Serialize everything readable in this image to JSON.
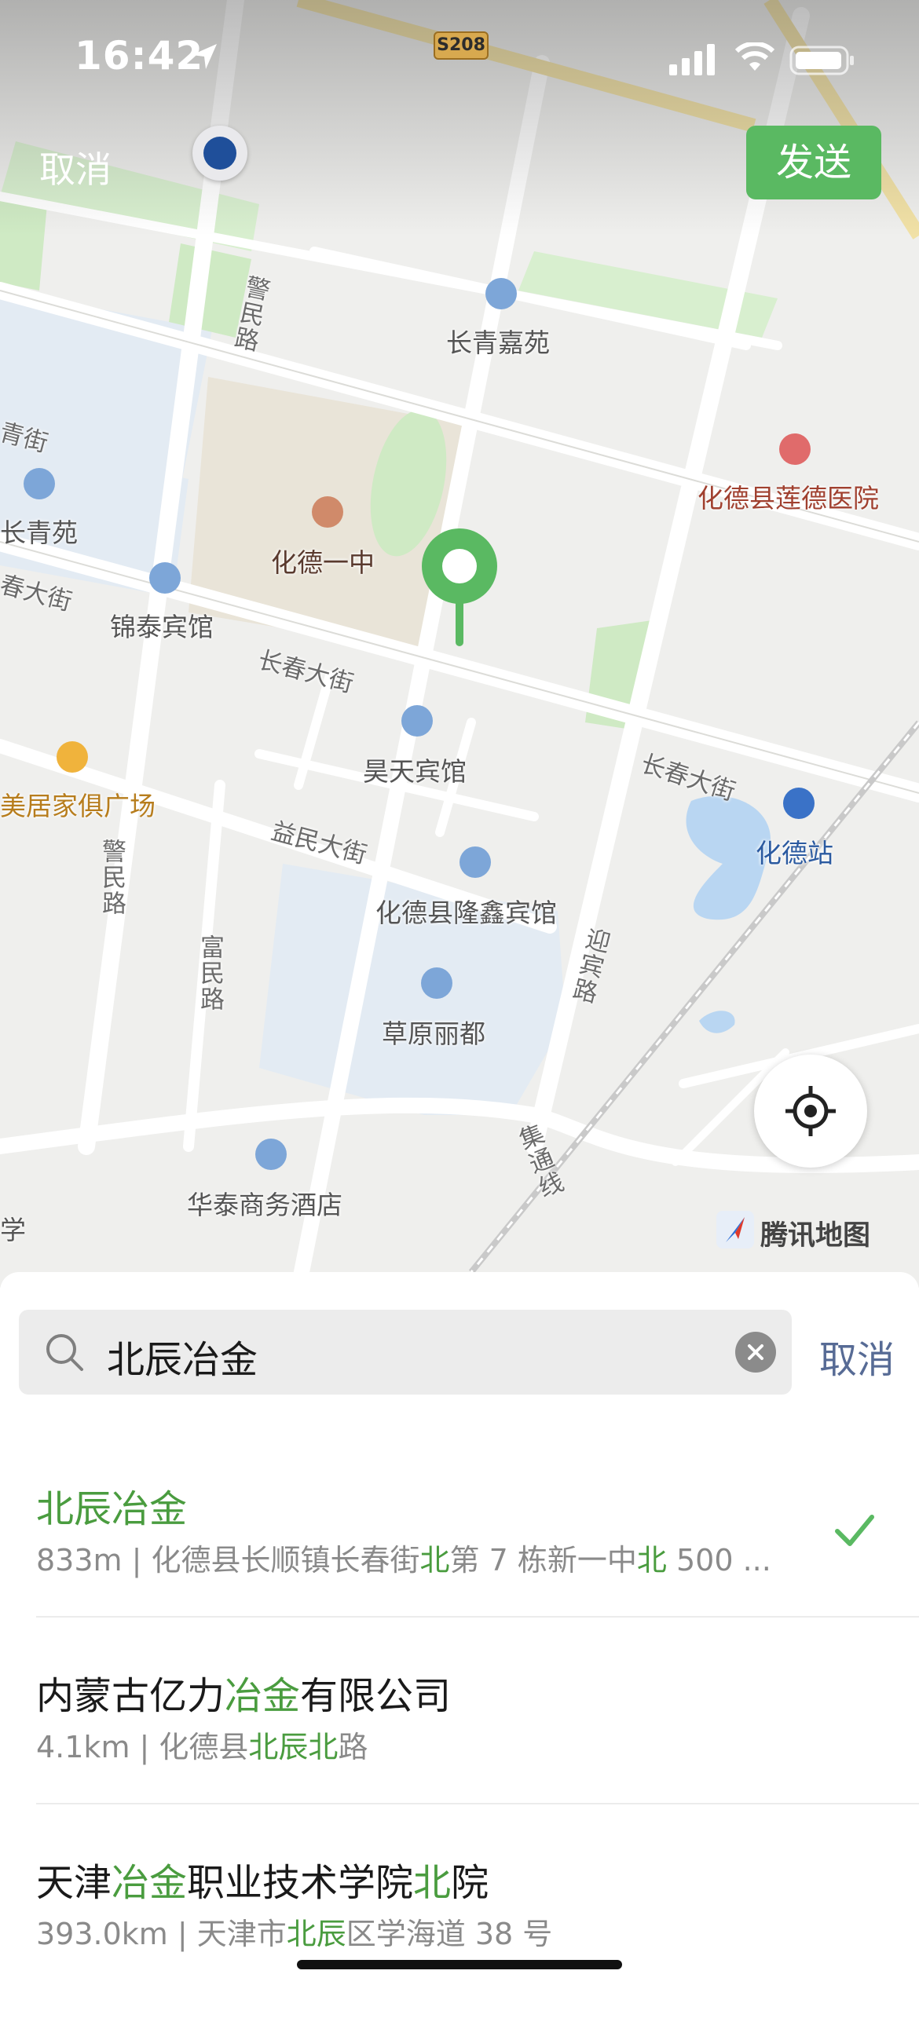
{
  "status_bar": {
    "time": "16:42"
  },
  "map": {
    "cancel_label": "取消",
    "send_label": "发送",
    "road_shield": "S208",
    "labels": {
      "changqing_jiayuan": "长青嘉苑",
      "jingmin_road_north": "警民路",
      "changqing_street": "青街",
      "changqing_yuan": "长青苑",
      "huade_no1": "化德一中",
      "lotus_hospital": "化德县莲德医院",
      "chun_street_west": "春大街",
      "jintai_hotel": "锦泰宾馆",
      "changchun_street_1": "长春大街",
      "haotian_hotel": "昊天宾馆",
      "changchun_street_2": "长春大街",
      "meiju_plaza": "美居家俱广场",
      "yimin_street": "益民大街",
      "huade_station": "化德站",
      "longxin_hotel": "化德县隆鑫宾馆",
      "jingmin_road_south": "警民路",
      "fumin_road": "富民路",
      "yingbin_road": "迎宾路",
      "caoyuan_lidu": "草原丽都",
      "huatai_hotel": "华泰商务酒店",
      "jitong_line": "集通线",
      "edge_school": "学"
    },
    "logo_text": "腾讯地图",
    "icons": [
      "location-arrow-icon",
      "signal-icon",
      "wifi-icon",
      "battery-icon",
      "user-location-icon",
      "map-pin-icon",
      "my-location-icon",
      "tencent-map-logo-icon"
    ]
  },
  "search": {
    "query": "北辰冶金",
    "cancel_label": "取消"
  },
  "results": [
    {
      "title_parts": [
        "北辰冶金"
      ],
      "sub_parts": [
        "833m | 化德县长顺镇长春街",
        "北",
        "第 7 栋新一中",
        "北",
        " 500 ..."
      ],
      "selected": true
    },
    {
      "title_parts": [
        "内蒙古亿力",
        "冶金",
        "有限公司"
      ],
      "sub_parts": [
        "4.1km | 化德县",
        "北辰北",
        "路"
      ],
      "selected": false
    },
    {
      "title_parts": [
        "天津",
        "冶金",
        "职业技术学院",
        "北",
        "院"
      ],
      "sub_parts": [
        "393.0km | 天津市",
        "北辰",
        "区学海道 38 号"
      ],
      "selected": false
    }
  ],
  "colors": {
    "accent_green": "#5ab962",
    "highlight_green": "#4a9c3f",
    "link_blue": "#576b95"
  }
}
